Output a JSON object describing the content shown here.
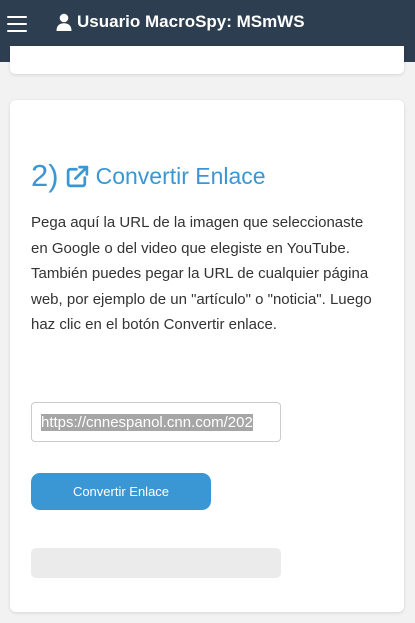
{
  "header": {
    "title": "Usuario MacroSpy: MSmWS",
    "menu_icon": "hamburger-menu-icon",
    "user_icon": "user-icon",
    "background": "#2d3e50"
  },
  "section": {
    "number": "2)",
    "icon": "external-link-icon",
    "title": "Convertir Enlace",
    "accent": "#3b97d3",
    "description": "Pega aquí la URL de la imagen que seleccionaste en Google o del video que elegiste en YouTube. También puedes pegar la URL de cualquier página web, por ejemplo de un \"artículo\" o \"noticia\". Luego haz clic en el botón Convertir enlace.",
    "url_value": "https://cnnespanol.cnn.com/202",
    "button_label": "Convertir Enlace"
  }
}
